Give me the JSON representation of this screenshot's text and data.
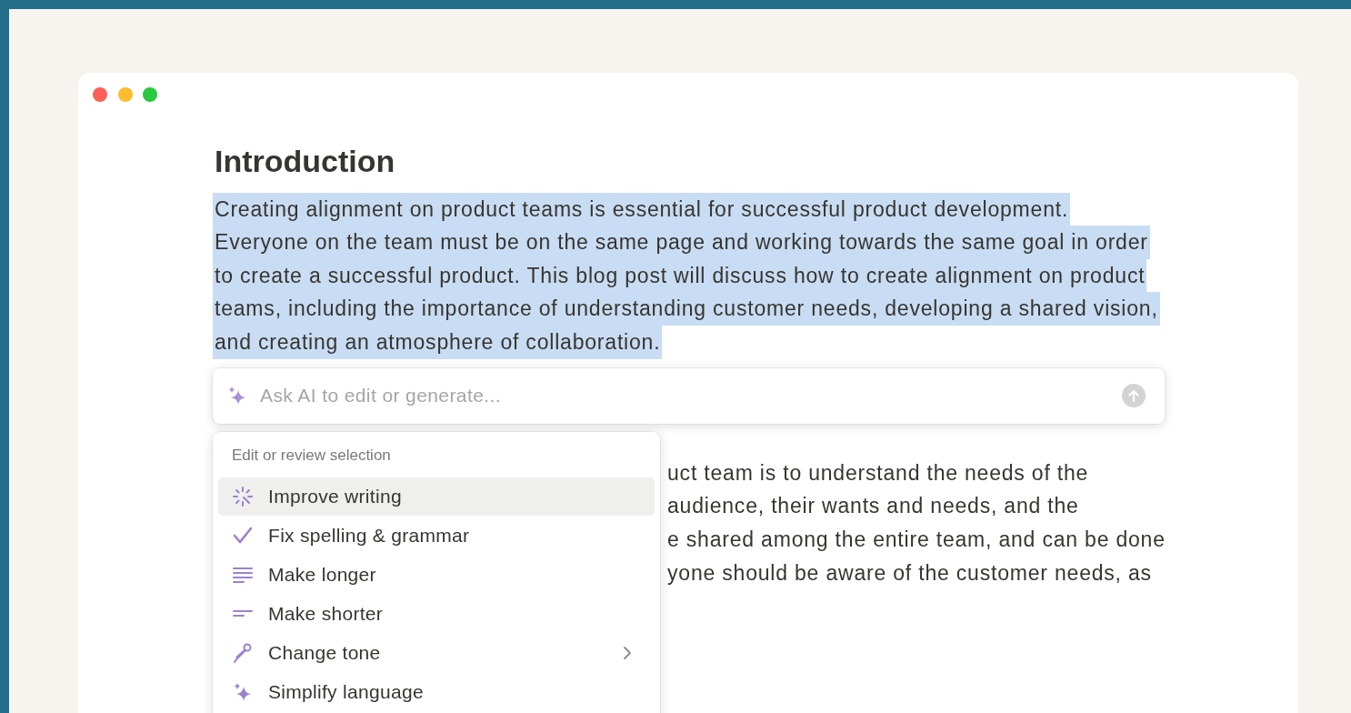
{
  "heading": "Introduction",
  "selected_paragraph": {
    "selected": true,
    "lines": [
      "Creating alignment on product teams is essential for successful product development.",
      "Everyone on the team must be on the same page and working towards the same goal in order",
      "to create a successful product. This blog post will discuss how to create alignment on product",
      "teams, including the importance of understanding customer needs, developing a shared vision,",
      "and creating an atmosphere of collaboration."
    ]
  },
  "ai_prompt": {
    "placeholder": "Ask AI to edit or generate..."
  },
  "covered_paragraph_lines": [
    "uct team is to understand the needs of the",
    "audience, their wants and needs, and the",
    "e shared among the entire team, and can be done",
    "yone should be aware of the customer needs, as"
  ],
  "menu": {
    "section_title": "Edit or review selection",
    "items": [
      {
        "kind": "improve",
        "label": "Improve writing",
        "selected": true,
        "has_submenu": false
      },
      {
        "kind": "fix",
        "label": "Fix spelling & grammar",
        "selected": false,
        "has_submenu": false
      },
      {
        "kind": "longer",
        "label": "Make longer",
        "selected": false,
        "has_submenu": false
      },
      {
        "kind": "shorter",
        "label": "Make shorter",
        "selected": false,
        "has_submenu": false
      },
      {
        "kind": "tone",
        "label": "Change tone",
        "selected": false,
        "has_submenu": true
      },
      {
        "kind": "simplify",
        "label": "Simplify language",
        "selected": false,
        "has_submenu": false
      }
    ]
  }
}
